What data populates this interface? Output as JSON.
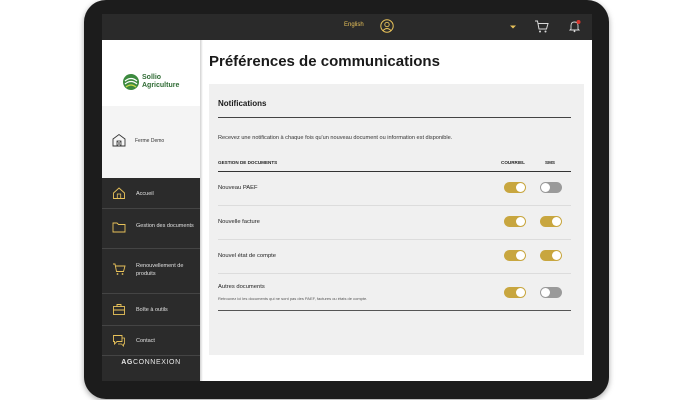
{
  "topbar": {
    "language": "English"
  },
  "sidebar": {
    "logo_line1": "Sollio",
    "logo_line2": "Agriculture",
    "farm_name": "Ferme Demo",
    "items": [
      {
        "label": "Accueil"
      },
      {
        "label": "Gestion des documents"
      },
      {
        "label": "Renouvellement de produits"
      },
      {
        "label": "Boîte à outils"
      },
      {
        "label": "Contact"
      }
    ],
    "footer_brand_bold": "AG",
    "footer_brand_rest": "CONNEXION"
  },
  "main": {
    "page_title": "Préférences de communications",
    "card_title": "Notifications",
    "description": "Recevez une notification à chaque fois qu'un nouveau document ou information est disponible.",
    "col_doc": "GESTION DE DOCUMENTS",
    "col_email": "COURRIEL",
    "col_sms": "SMS",
    "rows": [
      {
        "label": "Nouveau PAEF",
        "email": true,
        "sms": false
      },
      {
        "label": "Nouvelle facture",
        "email": true,
        "sms": true
      },
      {
        "label": "Nouvel état de compte",
        "email": true,
        "sms": true
      },
      {
        "label": "Autres documents",
        "sub": "Retrouvez ici les documents qui ne sont pas des PAEF, factures ou états de compte.",
        "email": true,
        "sms": false
      }
    ]
  },
  "colors": {
    "accent": "#c8a63f",
    "sidebar_dark": "#2b2b2b",
    "topbar": "#2a2a2a",
    "lang_text": "#e8c25a"
  }
}
